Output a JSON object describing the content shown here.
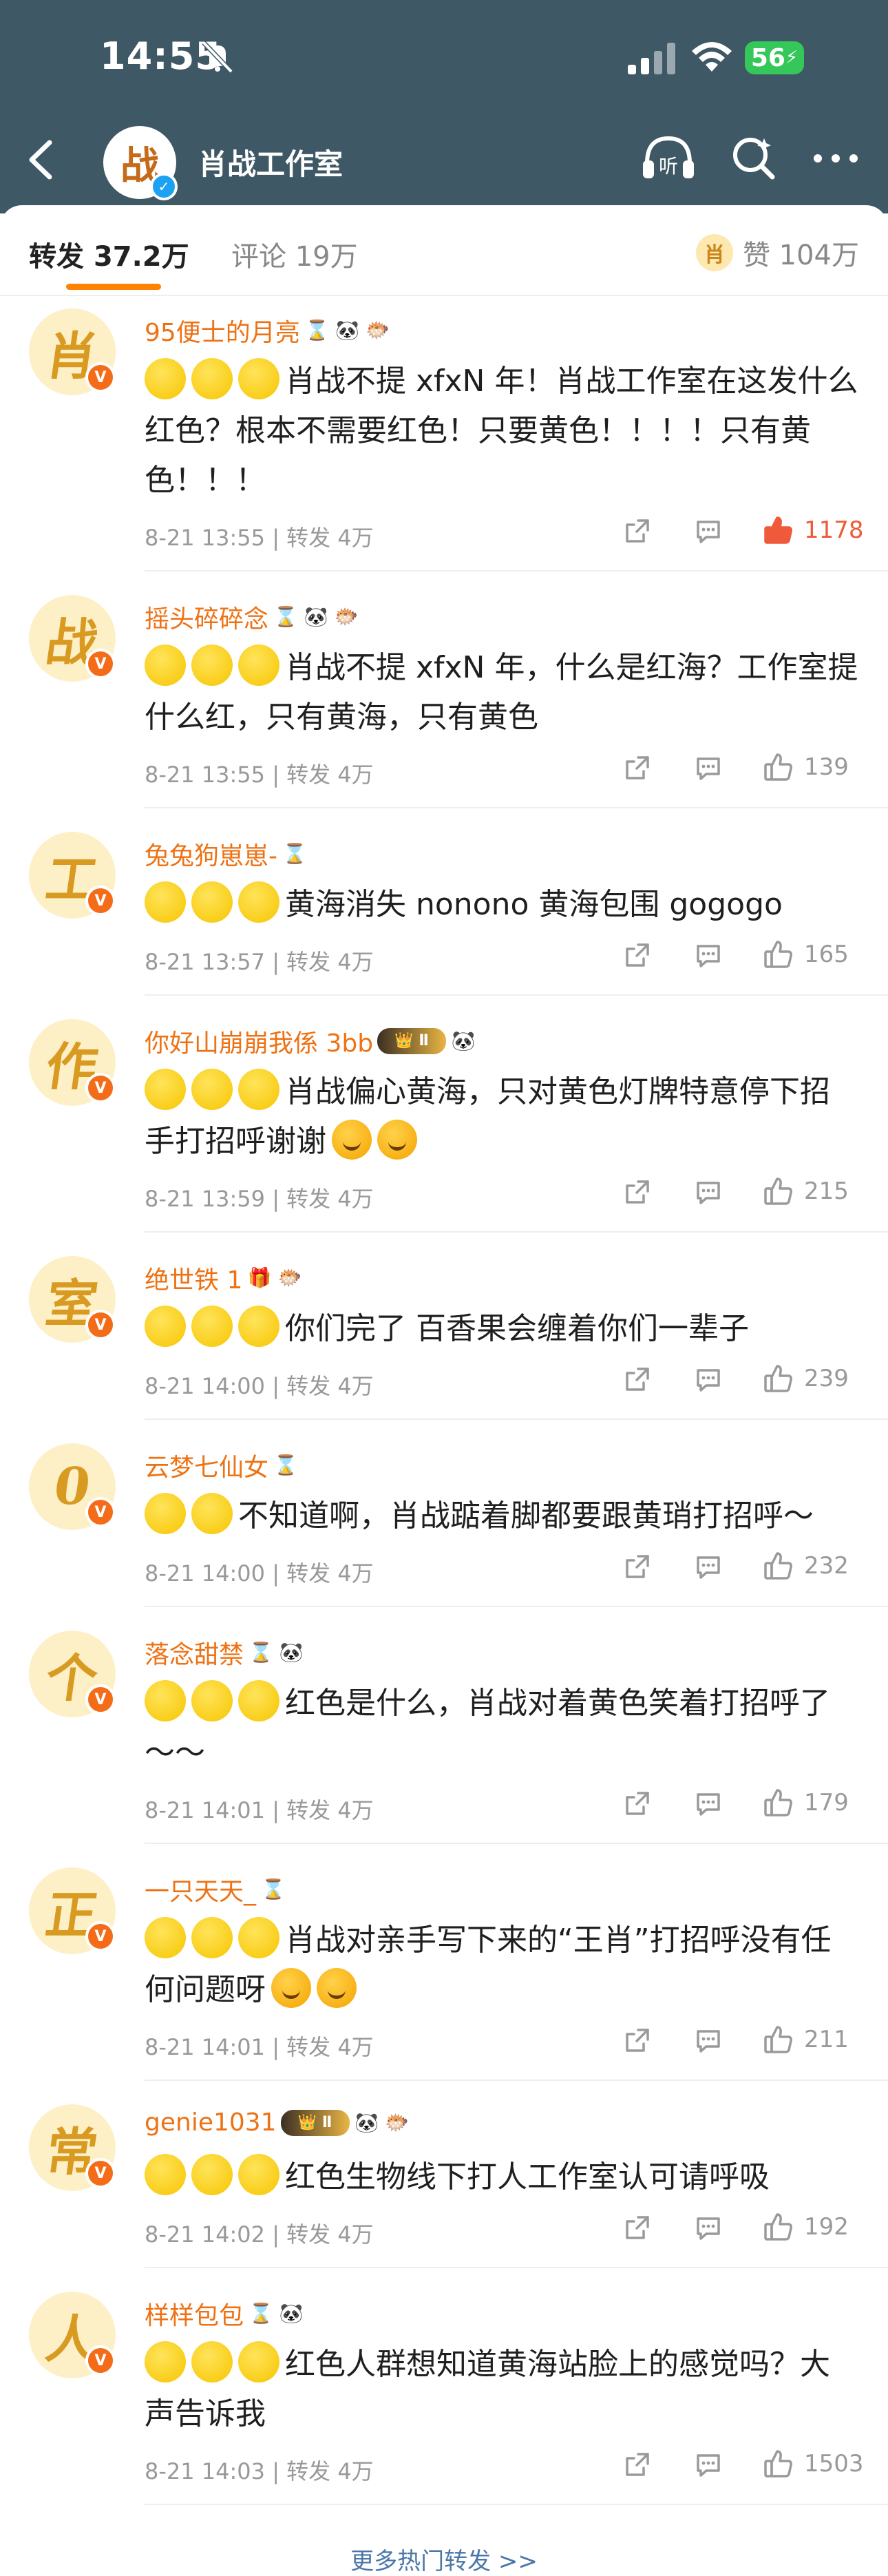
{
  "status": {
    "time": "14:55",
    "battery": "56"
  },
  "nav": {
    "title": "肖战工作室",
    "logo_char": "战"
  },
  "tabs": {
    "repost_label": "转发",
    "repost_count": "37.2万",
    "comment_label": "评论 19万",
    "likes_label": "赞 104万",
    "likes_avatar_char": "肖"
  },
  "reposts": [
    {
      "avatar_char": "肖",
      "username": "95便士的月亮",
      "badges": [
        "hourglass",
        "panda",
        "fish"
      ],
      "dots": 3,
      "text": "肖战不提 xfxN 年！肖战工作室在这发什么红色？根本不需要红色！只要黄色！！！！只有黄色！！！",
      "emojis": 0,
      "time": "8-21 13:55",
      "repost": "转发 4万",
      "likes": "1178",
      "liked": true
    },
    {
      "avatar_char": "战",
      "username": "摇头碎碎念",
      "badges": [
        "hourglass",
        "panda",
        "fish"
      ],
      "dots": 3,
      "text": "肖战不提 xfxN 年，什么是红海？工作室提什么红，只有黄海，只有黄色",
      "emojis": 0,
      "time": "8-21 13:55",
      "repost": "转发 4万",
      "likes": "139",
      "liked": false
    },
    {
      "avatar_char": "工",
      "username": "兔兔狗崽崽-",
      "badges": [
        "hourglass"
      ],
      "dots": 3,
      "text": "黄海消失 nonono 黄海包围 gogogo",
      "emojis": 0,
      "time": "8-21 13:57",
      "repost": "转发 4万",
      "likes": "165",
      "liked": false
    },
    {
      "avatar_char": "作",
      "username": "你好山崩崩我係 3bb",
      "badges": [
        "vip",
        "panda"
      ],
      "dots": 3,
      "text": "肖战偏心黄海，只对黄色灯牌特意停下招手打招呼谢谢",
      "emojis": 2,
      "time": "8-21 13:59",
      "repost": "转发 4万",
      "likes": "215",
      "liked": false
    },
    {
      "avatar_char": "室",
      "username": "绝世铁 1",
      "badges": [
        "gift",
        "fish"
      ],
      "dots": 3,
      "text": "你们完了 百香果会缠着你们一辈子",
      "emojis": 0,
      "time": "8-21 14:00",
      "repost": "转发 4万",
      "likes": "239",
      "liked": false
    },
    {
      "avatar_char": "0",
      "username": "云梦七仙女",
      "badges": [
        "hourglass"
      ],
      "dots": 2,
      "text": "不知道啊，肖战踮着脚都要跟黄琑打招呼～",
      "emojis": 0,
      "time": "8-21 14:00",
      "repost": "转发 4万",
      "likes": "232",
      "liked": false
    },
    {
      "avatar_char": "个",
      "username": "落念甜禁",
      "badges": [
        "hourglass",
        "panda"
      ],
      "dots": 3,
      "text": "红色是什么，肖战对着黄色笑着打招呼了～～",
      "emojis": 0,
      "time": "8-21 14:01",
      "repost": "转发 4万",
      "likes": "179",
      "liked": false
    },
    {
      "avatar_char": "正",
      "username": "一只天天_",
      "badges": [
        "hourglass"
      ],
      "dots": 3,
      "text": "肖战对亲手写下来的“王肖”打招呼没有任何问题呀",
      "emojis": 2,
      "time": "8-21 14:01",
      "repost": "转发 4万",
      "likes": "211",
      "liked": false
    },
    {
      "avatar_char": "常",
      "username": "genie1031",
      "badges": [
        "vip",
        "panda",
        "fish"
      ],
      "dots": 3,
      "text": "红色生物线下打人工作室认可请呼吸",
      "emojis": 0,
      "time": "8-21 14:02",
      "repost": "转发 4万",
      "likes": "192",
      "liked": false
    },
    {
      "avatar_char": "人",
      "username": "样样包包",
      "badges": [
        "hourglass",
        "panda"
      ],
      "dots": 3,
      "text": "红色人群想知道黄海站脸上的感觉吗？大声告诉我",
      "emojis": 0,
      "time": "8-21 14:03",
      "repost": "转发 4万",
      "likes": "1503",
      "liked": false
    }
  ],
  "more_link": "更多热门转发 >>",
  "colors": {
    "nav_bg": "#3f5865",
    "accent": "#ff8200",
    "username": "#ee7214",
    "like_active": "#ee5a3a"
  }
}
